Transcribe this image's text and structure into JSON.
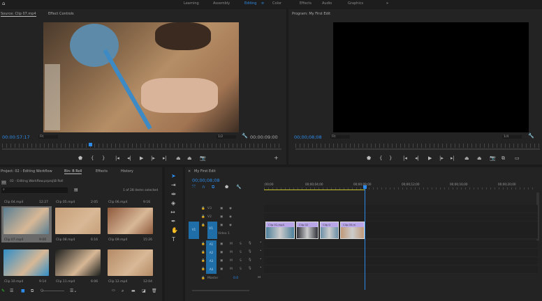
{
  "topbar": {
    "workspaces": [
      "Learning",
      "Assembly",
      "Editing",
      "Color",
      "Effects",
      "Audio",
      "Graphics"
    ],
    "active": "Editing",
    "accent": "#2d8ceb"
  },
  "source": {
    "tab": "Source: Clip 07.mp4",
    "tab2": "Effect Controls",
    "timecode": "00:00:57:17",
    "fit": "Fit",
    "resolution": "1/2",
    "duration": "00:00:09:00",
    "playhead_fraction": 0.31
  },
  "program": {
    "tab": "Program: My First Edit",
    "timecode": "00;00;08;08",
    "fit": "Fit",
    "resolution": "1/4"
  },
  "project": {
    "tabs": [
      "Project: 02 - Editing Workflow",
      "Bin: B Roll",
      "Effects",
      "History"
    ],
    "active_tab": "Bin: B Roll",
    "path": "02 - Editing Workflow.prproj\\B Roll",
    "status": "1 of 28 items selected",
    "top_row": [
      {
        "name": "Clip 04.mp4",
        "dur": "12:27"
      },
      {
        "name": "Clip 05.mp4",
        "dur": "2:05"
      },
      {
        "name": "Clip 06.mp4",
        "dur": "9:16"
      }
    ],
    "clips": [
      {
        "name": "Clip 07.mp4",
        "dur": "9:00",
        "color": "#5a7f94"
      },
      {
        "name": "Clip 08.mp4",
        "dur": "6:16",
        "color": "#c7a07a"
      },
      {
        "name": "Clip 09.mp4",
        "dur": "15:26",
        "color": "#8f5a3e"
      },
      {
        "name": "Clip 10.mp4",
        "dur": "9:14",
        "color": "#2f8dc6"
      },
      {
        "name": "Clip 11.mp4",
        "dur": "6:06",
        "color": "#1c1f1e"
      },
      {
        "name": "Clip 12.mp4",
        "dur": "12:04",
        "color": "#b58a66"
      }
    ]
  },
  "timeline": {
    "tab": "My First Edit",
    "timecode": "00;00;08;08",
    "ruler": [
      ";00;00",
      "00;00;04;00",
      "00;00;08;00",
      "00;00;12;00",
      "00;00;16;00",
      "00;00;20;00"
    ],
    "video_tracks": [
      "V3",
      "V2",
      "V1"
    ],
    "v1_name": "Video 1",
    "source_patch": "V1",
    "audio_tracks": [
      "A1",
      "A2",
      "A3",
      "A4"
    ],
    "mute": "M",
    "solo": "S",
    "master": "Master",
    "master_value": "0.0",
    "clips": [
      "Clip 01.mp4",
      "Clip 02",
      "Clip 0",
      "Clip 05.m"
    ]
  }
}
